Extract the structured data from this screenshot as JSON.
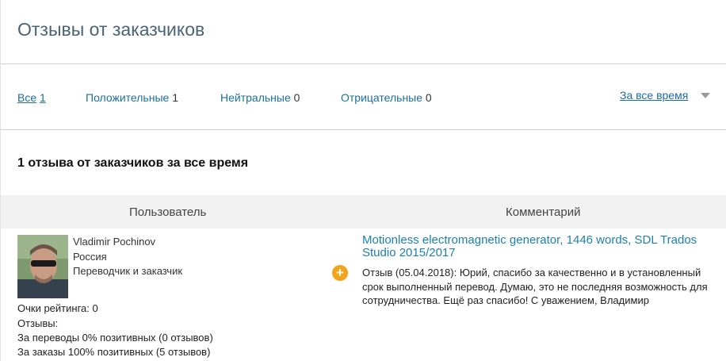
{
  "page": {
    "title": "Отзывы от заказчиков"
  },
  "filters": [
    {
      "label": "Все",
      "count": "1"
    },
    {
      "label": "Положительные",
      "count": "1"
    },
    {
      "label": "Нейтральные",
      "count": "0"
    },
    {
      "label": "Отрицательные",
      "count": "0"
    }
  ],
  "period": {
    "label": "За все время",
    "icon": "chevron-down-icon"
  },
  "summary": "1 отзыва от заказчиков за все время",
  "table": {
    "headers": {
      "user": "Пользователь",
      "comment": "Комментарий"
    }
  },
  "review": {
    "user": {
      "name": "Vladimir Pochinov",
      "country": "Россия",
      "role": "Переводчик и заказчик",
      "rating": "Очки рейтинга: 0",
      "reviews_label": "Отзывы:",
      "translations": "За переводы 0% позитивных (0 отзывов)",
      "orders": "За заказы 100% позитивных (5 отзывов)"
    },
    "project": "Motionless electromagnetic generator, 1446 words, SDL Trados Studio 2015/2017",
    "text": "Отзыв (05.04.2018): Юрий, спасибо за качественно и в установленный срок выполненный перевод. Думаю, это не последняя возможность для сотрудничества. Ещё раз спасибо! С уважением, Владимир",
    "badge_icon": "plus-icon"
  },
  "colors": {
    "link": "#1d6e9e",
    "title": "#4a6375",
    "badge": "#f0a51c",
    "header_bg": "#f2f2f2"
  }
}
